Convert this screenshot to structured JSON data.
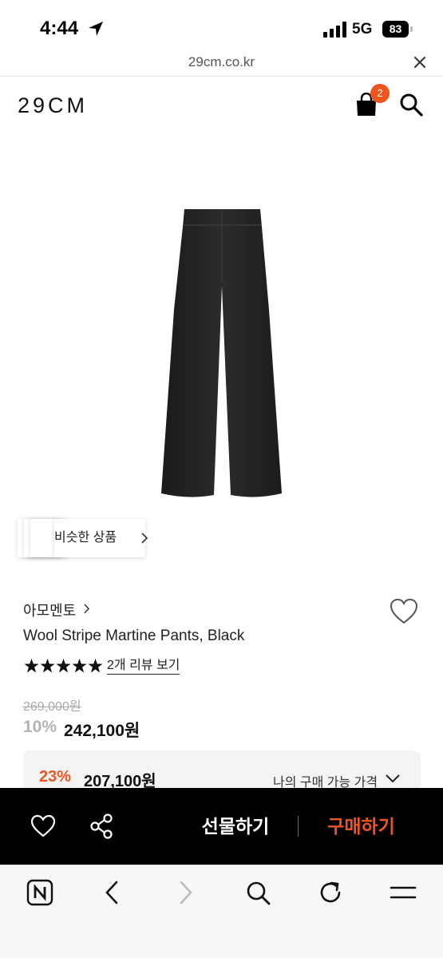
{
  "status_bar": {
    "time": "4:44",
    "network": "5G",
    "battery": "83"
  },
  "browser": {
    "url": "29cm.co.kr"
  },
  "header": {
    "logo": "29CM",
    "cart_count": "2"
  },
  "similar_products": {
    "label": "비슷한 상품"
  },
  "product": {
    "brand": "아모멘토",
    "name": "Wool Stripe Martine Pants, Black",
    "rating": 5,
    "review_link": "2개 리뷰 보기",
    "original_price": "269,000원",
    "discount_rate": "10%",
    "sale_price": "242,100원"
  },
  "my_price": {
    "discount_rate": "23%",
    "price": "207,100원",
    "label": "나의 구매 가능 가격"
  },
  "action_bar": {
    "gift_label": "선물하기",
    "buy_label": "구매하기"
  },
  "colors": {
    "accent": "#f0551f",
    "action_bar_bg": "#000000"
  },
  "toolbar_icons": [
    "naver-n-icon",
    "back-icon",
    "forward-icon",
    "search-icon",
    "reload-icon",
    "menu-icon"
  ]
}
